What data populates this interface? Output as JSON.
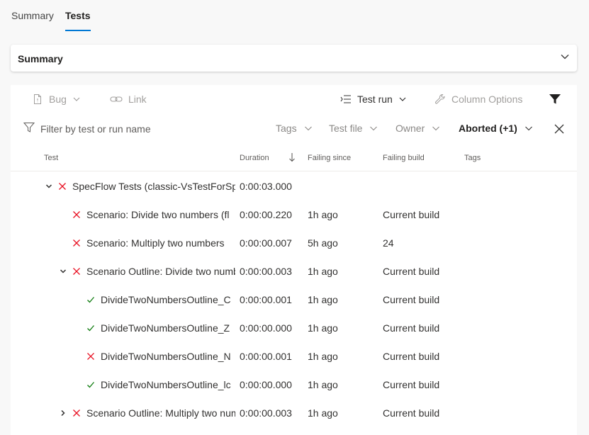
{
  "tabs": [
    {
      "label": "Summary",
      "active": false
    },
    {
      "label": "Tests",
      "active": true
    }
  ],
  "summary_section": {
    "title": "Summary"
  },
  "toolbar": {
    "bug": "Bug",
    "link": "Link",
    "test_run": "Test run",
    "column_options": "Column Options"
  },
  "filter": {
    "placeholder": "Filter by test or run name",
    "tags": "Tags",
    "test_file": "Test file",
    "owner": "Owner",
    "outcome": "Aborted (+1)"
  },
  "columns": {
    "test": "Test",
    "duration": "Duration",
    "failing_since": "Failing since",
    "failing_build": "Failing build",
    "tags": "Tags"
  },
  "colors": {
    "accent": "#0078d4",
    "fail": "#e81123",
    "pass": "#107c10"
  },
  "rows": [
    {
      "name": "SpecFlow Tests (classic-VsTestForSpecFlow)",
      "duration": "0:00:03.000",
      "failing_since": "",
      "failing_build": "",
      "status": "failed",
      "level": 0,
      "expander": "expanded"
    },
    {
      "name": "Scenario: Divide two numbers (fl",
      "duration": "0:00:00.220",
      "failing_since": "1h ago",
      "failing_build": "Current build",
      "status": "failed",
      "level": 1,
      "expander": "none"
    },
    {
      "name": "Scenario: Multiply two numbers",
      "duration": "0:00:00.007",
      "failing_since": "5h ago",
      "failing_build": "24",
      "status": "failed",
      "level": 1,
      "expander": "none"
    },
    {
      "name": "Scenario Outline: Divide two numbers",
      "duration": "0:00:00.003",
      "failing_since": "1h ago",
      "failing_build": "Current build",
      "status": "failed",
      "level": 1,
      "expander": "expanded"
    },
    {
      "name": "DivideTwoNumbersOutline_C",
      "duration": "0:00:00.001",
      "failing_since": "1h ago",
      "failing_build": "Current build",
      "status": "passed",
      "level": 2,
      "expander": "none"
    },
    {
      "name": "DivideTwoNumbersOutline_Z",
      "duration": "0:00:00.000",
      "failing_since": "1h ago",
      "failing_build": "Current build",
      "status": "passed",
      "level": 2,
      "expander": "none"
    },
    {
      "name": "DivideTwoNumbersOutline_N",
      "duration": "0:00:00.001",
      "failing_since": "1h ago",
      "failing_build": "Current build",
      "status": "failed",
      "level": 2,
      "expander": "none"
    },
    {
      "name": "DivideTwoNumbersOutline_lc",
      "duration": "0:00:00.000",
      "failing_since": "1h ago",
      "failing_build": "Current build",
      "status": "passed",
      "level": 2,
      "expander": "none"
    },
    {
      "name": "Scenario Outline: Multiply two numbers",
      "duration": "0:00:00.003",
      "failing_since": "1h ago",
      "failing_build": "Current build",
      "status": "failed",
      "level": 1,
      "expander": "collapsed"
    }
  ]
}
